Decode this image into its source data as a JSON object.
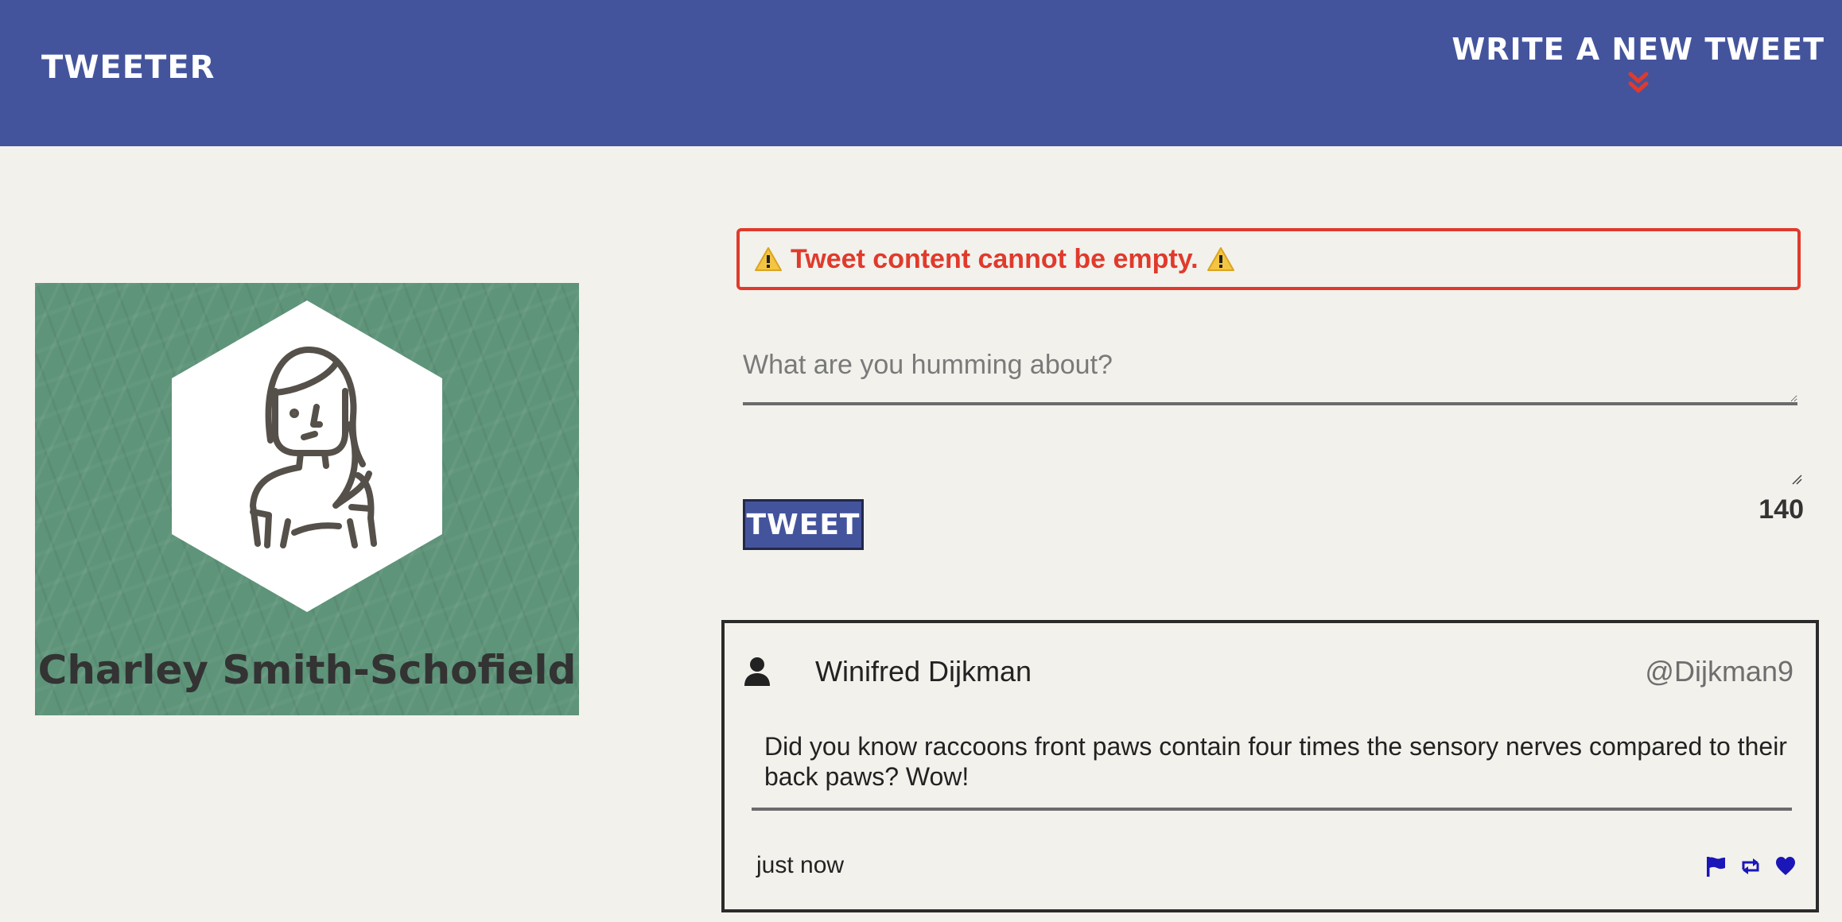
{
  "nav": {
    "brand": "TWEETER",
    "compose_label": "WRITE A NEW TWEET"
  },
  "profile": {
    "name": "Charley Smith-Schofield"
  },
  "error": {
    "message": "Tweet content cannot be empty."
  },
  "compose": {
    "placeholder": "What are you humming about?",
    "value": "",
    "button_label": "TWEET",
    "char_count": "140"
  },
  "tweets": [
    {
      "author": "Winifred Dijkman",
      "handle": "@Dijkman9",
      "content": "Did you know raccoons front paws contain four times the sensory nerves compared to their back paws? Wow!",
      "time": "just now",
      "actions": [
        "flag-icon",
        "retweet-icon",
        "heart-icon"
      ]
    }
  ],
  "colors": {
    "nav_bg": "#44549c",
    "page_bg": "#f2f1ec",
    "error": "#e03a2c",
    "profile_bg": "#5e9479",
    "action_icons": "#1a16b8"
  }
}
